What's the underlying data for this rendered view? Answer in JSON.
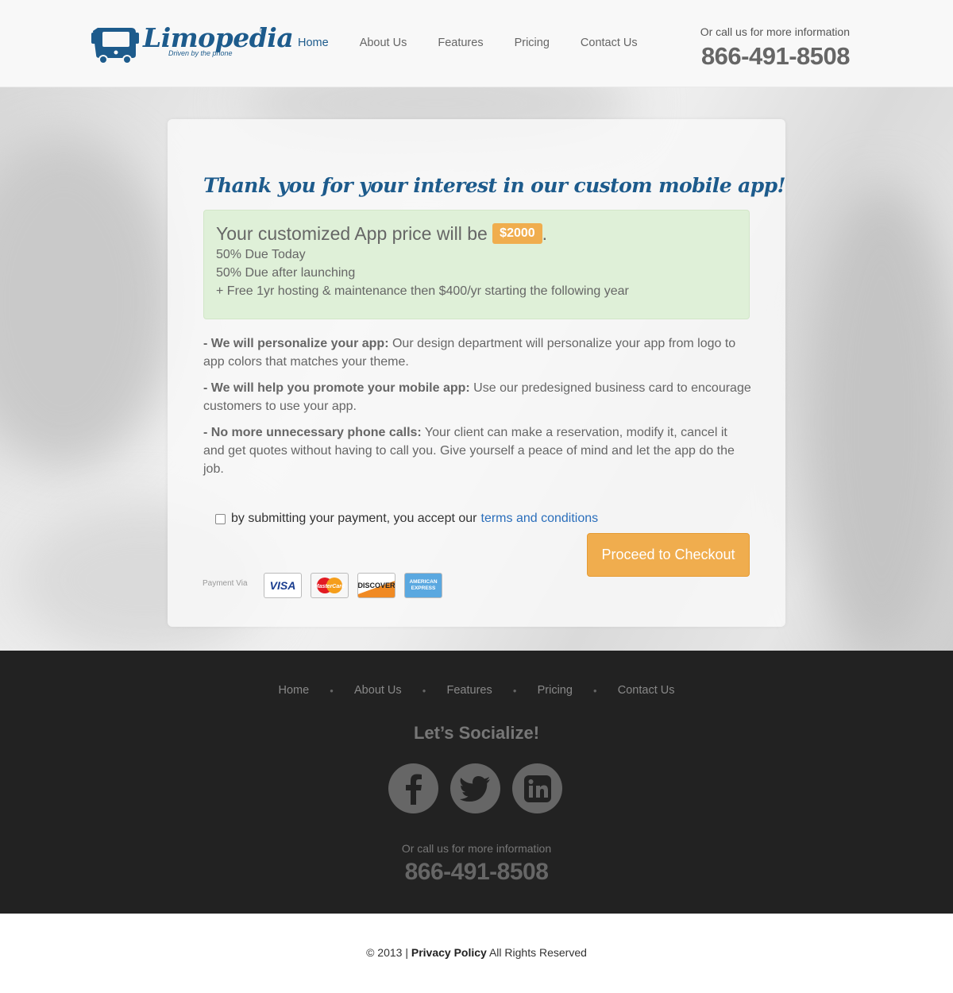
{
  "header": {
    "logo_text": "Limopedia",
    "logo_reg": "®",
    "logo_tagline": "Driven by the phone",
    "nav": [
      "Home",
      "About Us",
      "Features",
      "Pricing",
      "Contact Us"
    ],
    "active_nav": "Home",
    "contact_label": "Or call us for more information",
    "phone": "866-491-8508"
  },
  "main": {
    "title": "Thank you for your interest in our custom mobile app!",
    "price_prefix": "Your customized App price will be",
    "price": "$2000",
    "price_suffix": ".",
    "terms_lines": [
      "50% Due Today",
      "50% Due after launching",
      "+ Free 1yr hosting & maintenance then $400/yr starting the following year"
    ],
    "features": [
      {
        "heading": "- We will personalize your app:",
        "text": " Our design department will personalize your app from logo to app colors that matches your theme."
      },
      {
        "heading": "- We will help you promote your mobile app:",
        "text": " Use our predesigned business card to encourage customers to use your app."
      },
      {
        "heading": "- No more unnecessary phone calls:",
        "text": " Your client can make a reservation, modify it, cancel it and get quotes without having to call you. Give yourself a peace of mind and let the app do the job."
      }
    ],
    "agreement_text": "by submitting your payment, you accept our",
    "agreement_link": "terms and conditions",
    "payment_label": "Payment Via",
    "payment_methods": [
      "VISA",
      "MasterCard",
      "DISCOVER",
      "AMERICAN EXPRESS"
    ],
    "checkout_label": "Proceed to Checkout"
  },
  "footer": {
    "nav": [
      "Home",
      "About Us",
      "Features",
      "Pricing",
      "Contact Us"
    ],
    "social_title": "Let’s Socialize!",
    "socials": [
      "facebook-icon",
      "twitter-icon",
      "linkedin-icon"
    ],
    "contact_label": "Or call us for more information",
    "phone": "866-491-8508"
  },
  "copyright": {
    "prefix": "© 2013 |",
    "link": "Privacy Policy",
    "suffix": "All Rights Reserved"
  },
  "colors": {
    "brand": "#1d5b8c",
    "accent": "#f0ad4e",
    "success_bg": "#dff0d8",
    "footer_bg": "#222222"
  }
}
